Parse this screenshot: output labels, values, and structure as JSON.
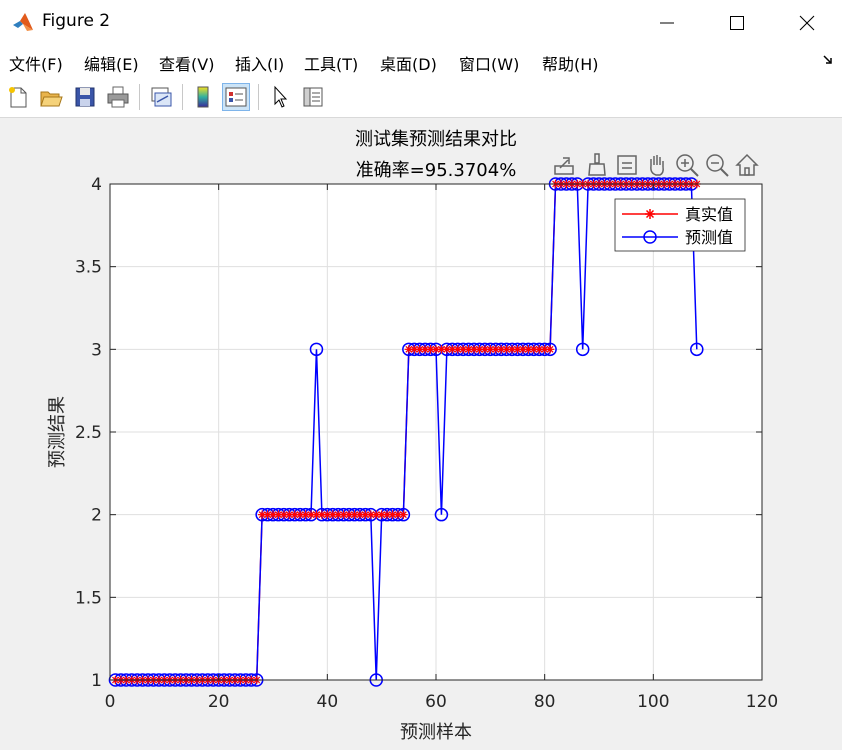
{
  "window": {
    "title": "Figure 2",
    "icon": "matlab-icon",
    "controls": [
      "minimize-icon",
      "maximize-icon",
      "close-icon"
    ]
  },
  "menu": {
    "items": [
      "文件(F)",
      "编辑(E)",
      "查看(V)",
      "插入(I)",
      "工具(T)",
      "桌面(D)",
      "窗口(W)",
      "帮助(H)"
    ]
  },
  "toolbar": {
    "buttons": [
      "new-figure-icon",
      "open-file-icon",
      "save-icon",
      "print-icon",
      "link-plot-icon",
      "colorbar-icon",
      "legend-icon",
      "edit-plot-icon",
      "property-inspector-icon"
    ]
  },
  "axes_toolbar": {
    "buttons": [
      "export-icon",
      "brush-icon",
      "data-tips-icon",
      "pan-icon",
      "zoom-in-icon",
      "zoom-out-icon",
      "home-icon"
    ]
  },
  "chart_data": {
    "type": "line",
    "title": "测试集预测结果对比",
    "subtitle": "准确率=95.3704%",
    "xlabel": "预测样本",
    "ylabel": "预测结果",
    "xlim": [
      0,
      120
    ],
    "ylim": [
      1,
      4
    ],
    "xticks": [
      0,
      20,
      40,
      60,
      80,
      100,
      120
    ],
    "yticks": [
      1,
      1.5,
      2,
      2.5,
      3,
      3.5,
      4
    ],
    "xtick_labels": [
      "0",
      "20",
      "40",
      "60",
      "80",
      100,
      "120"
    ],
    "ytick_labels": [
      "1",
      "1.5",
      "2",
      "2.5",
      "3",
      "3.5",
      "4"
    ],
    "grid": true,
    "legend_position": "top-right",
    "x": [
      1,
      2,
      3,
      4,
      5,
      6,
      7,
      8,
      9,
      10,
      11,
      12,
      13,
      14,
      15,
      16,
      17,
      18,
      19,
      20,
      21,
      22,
      23,
      24,
      25,
      26,
      27,
      28,
      29,
      30,
      31,
      32,
      33,
      34,
      35,
      36,
      37,
      38,
      39,
      40,
      41,
      42,
      43,
      44,
      45,
      46,
      47,
      48,
      49,
      50,
      51,
      52,
      53,
      54,
      55,
      56,
      57,
      58,
      59,
      60,
      61,
      62,
      63,
      64,
      65,
      66,
      67,
      68,
      69,
      70,
      71,
      72,
      73,
      74,
      75,
      76,
      77,
      78,
      79,
      80,
      81,
      82,
      83,
      84,
      85,
      86,
      87,
      88,
      89,
      90,
      91,
      92,
      93,
      94,
      95,
      96,
      97,
      98,
      99,
      100,
      101,
      102,
      103,
      104,
      105,
      106,
      107,
      108
    ],
    "series": [
      {
        "name": "真实值",
        "color": "#ff0000",
        "marker": "asterisk",
        "values": [
          1,
          1,
          1,
          1,
          1,
          1,
          1,
          1,
          1,
          1,
          1,
          1,
          1,
          1,
          1,
          1,
          1,
          1,
          1,
          1,
          1,
          1,
          1,
          1,
          1,
          1,
          1,
          2,
          2,
          2,
          2,
          2,
          2,
          2,
          2,
          2,
          2,
          2,
          2,
          2,
          2,
          2,
          2,
          2,
          2,
          2,
          2,
          2,
          2,
          2,
          2,
          2,
          2,
          2,
          3,
          3,
          3,
          3,
          3,
          3,
          3,
          3,
          3,
          3,
          3,
          3,
          3,
          3,
          3,
          3,
          3,
          3,
          3,
          3,
          3,
          3,
          3,
          3,
          3,
          3,
          3,
          4,
          4,
          4,
          4,
          4,
          4,
          4,
          4,
          4,
          4,
          4,
          4,
          4,
          4,
          4,
          4,
          4,
          4,
          4,
          4,
          4,
          4,
          4,
          4,
          4,
          4,
          4
        ]
      },
      {
        "name": "预测值",
        "color": "#0000ff",
        "marker": "circle",
        "values": [
          1,
          1,
          1,
          1,
          1,
          1,
          1,
          1,
          1,
          1,
          1,
          1,
          1,
          1,
          1,
          1,
          1,
          1,
          1,
          1,
          1,
          1,
          1,
          1,
          1,
          1,
          1,
          2,
          2,
          2,
          2,
          2,
          2,
          2,
          2,
          2,
          2,
          3,
          2,
          2,
          2,
          2,
          2,
          2,
          2,
          2,
          2,
          2,
          1,
          2,
          2,
          2,
          2,
          2,
          3,
          3,
          3,
          3,
          3,
          3,
          2,
          3,
          3,
          3,
          3,
          3,
          3,
          3,
          3,
          3,
          3,
          3,
          3,
          3,
          3,
          3,
          3,
          3,
          3,
          3,
          3,
          4,
          4,
          4,
          4,
          4,
          3,
          4,
          4,
          4,
          4,
          4,
          4,
          4,
          4,
          4,
          4,
          4,
          4,
          4,
          4,
          4,
          4,
          4,
          4,
          4,
          4,
          3
        ]
      }
    ]
  }
}
